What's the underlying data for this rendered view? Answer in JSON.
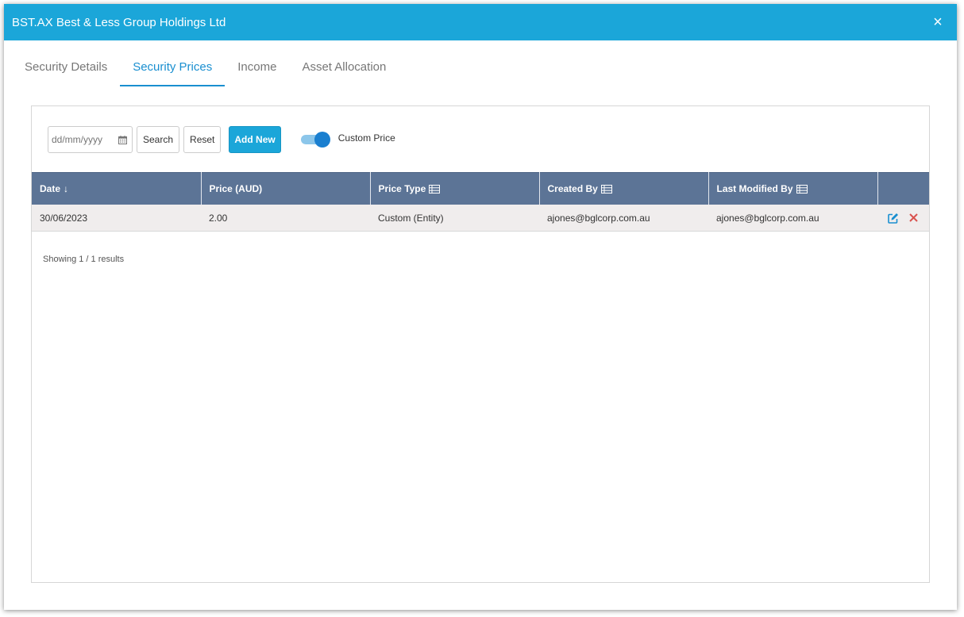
{
  "dialog": {
    "title": "BST.AX Best & Less Group Holdings Ltd",
    "close_glyph": "×"
  },
  "tabs": [
    {
      "label": "Security Details",
      "active": false
    },
    {
      "label": "Security Prices",
      "active": true
    },
    {
      "label": "Income",
      "active": false
    },
    {
      "label": "Asset Allocation",
      "active": false
    }
  ],
  "toolbar": {
    "date_placeholder": "dd/mm/yyyy",
    "date_icon": "calendar-icon",
    "search_label": "Search",
    "reset_label": "Reset",
    "add_new_label": "Add New",
    "custom_price_label": "Custom Price",
    "custom_price_enabled": true
  },
  "table": {
    "columns": [
      "Date",
      "Price (AUD)",
      "Price Type",
      "Created By",
      "Last Modified By",
      ""
    ],
    "sort_indicator": "↓",
    "rows": [
      {
        "date": "30/06/2023",
        "price": "2.00",
        "price_type": "Custom (Entity)",
        "created_by": "ajones@bglcorp.com.au",
        "last_modified_by": "ajones@bglcorp.com.au"
      }
    ]
  },
  "footer": {
    "results_text": "Showing 1 / 1 results"
  },
  "colors": {
    "accent": "#1ba6d9",
    "header_bg": "#5c7496",
    "row_bg": "#f0eded",
    "delete": "#d9534f",
    "edit": "#1a8fd0"
  }
}
